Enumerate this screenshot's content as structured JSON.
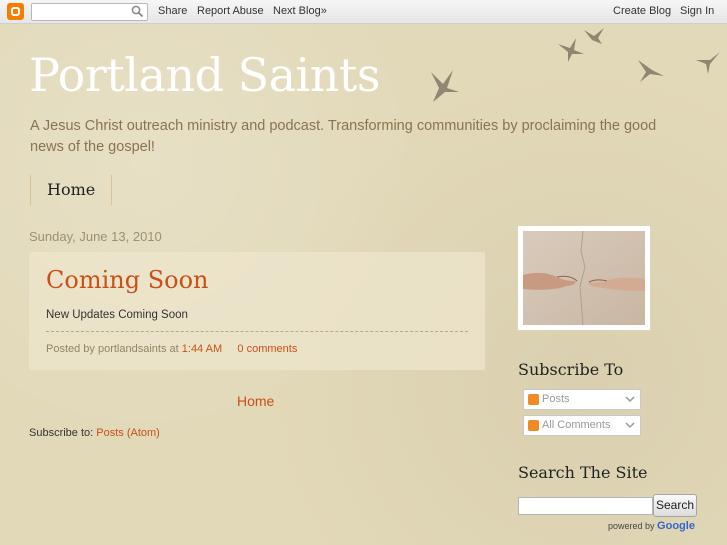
{
  "navbar": {
    "links": {
      "share": "Share",
      "report_abuse": "Report Abuse",
      "next_blog": "Next Blog»",
      "create_blog": "Create Blog",
      "sign_in": "Sign In"
    },
    "search_placeholder": "",
    "icons": [
      "blogger-logo-icon",
      "search-icon"
    ]
  },
  "header": {
    "title": "Portland Saints",
    "description": "A Jesus Christ outreach ministry and podcast. Transforming communities by proclaiming the good news of the gospel!"
  },
  "tabs": [
    {
      "label": "Home"
    }
  ],
  "post": {
    "date": "Sunday, June 13, 2010",
    "title": "Coming Soon",
    "body": "New Updates Coming Soon",
    "footer": {
      "posted_by": "Posted by portlandsaints at",
      "time": "1:44 AM",
      "comments": "0 comments"
    }
  },
  "home_link": "Home",
  "subscribe": {
    "label": "Subscribe to:",
    "link": "Posts (Atom)"
  },
  "sidebar": {
    "image_alt": "creation-of-adam-image",
    "subscribe_title": "Subscribe To",
    "feeds": [
      {
        "label": "Posts"
      },
      {
        "label": "All Comments"
      }
    ],
    "search_title": "Search The Site",
    "search_value": "",
    "search_button": "Search",
    "powered_by": "powered by",
    "google": "Google"
  },
  "colors": {
    "background": "#e2d9b9",
    "title": "#ffffff",
    "accent": "#c8501a",
    "description": "#8a7352",
    "feed_icon": "#f08a24",
    "blogger_orange": "#f57d00"
  }
}
